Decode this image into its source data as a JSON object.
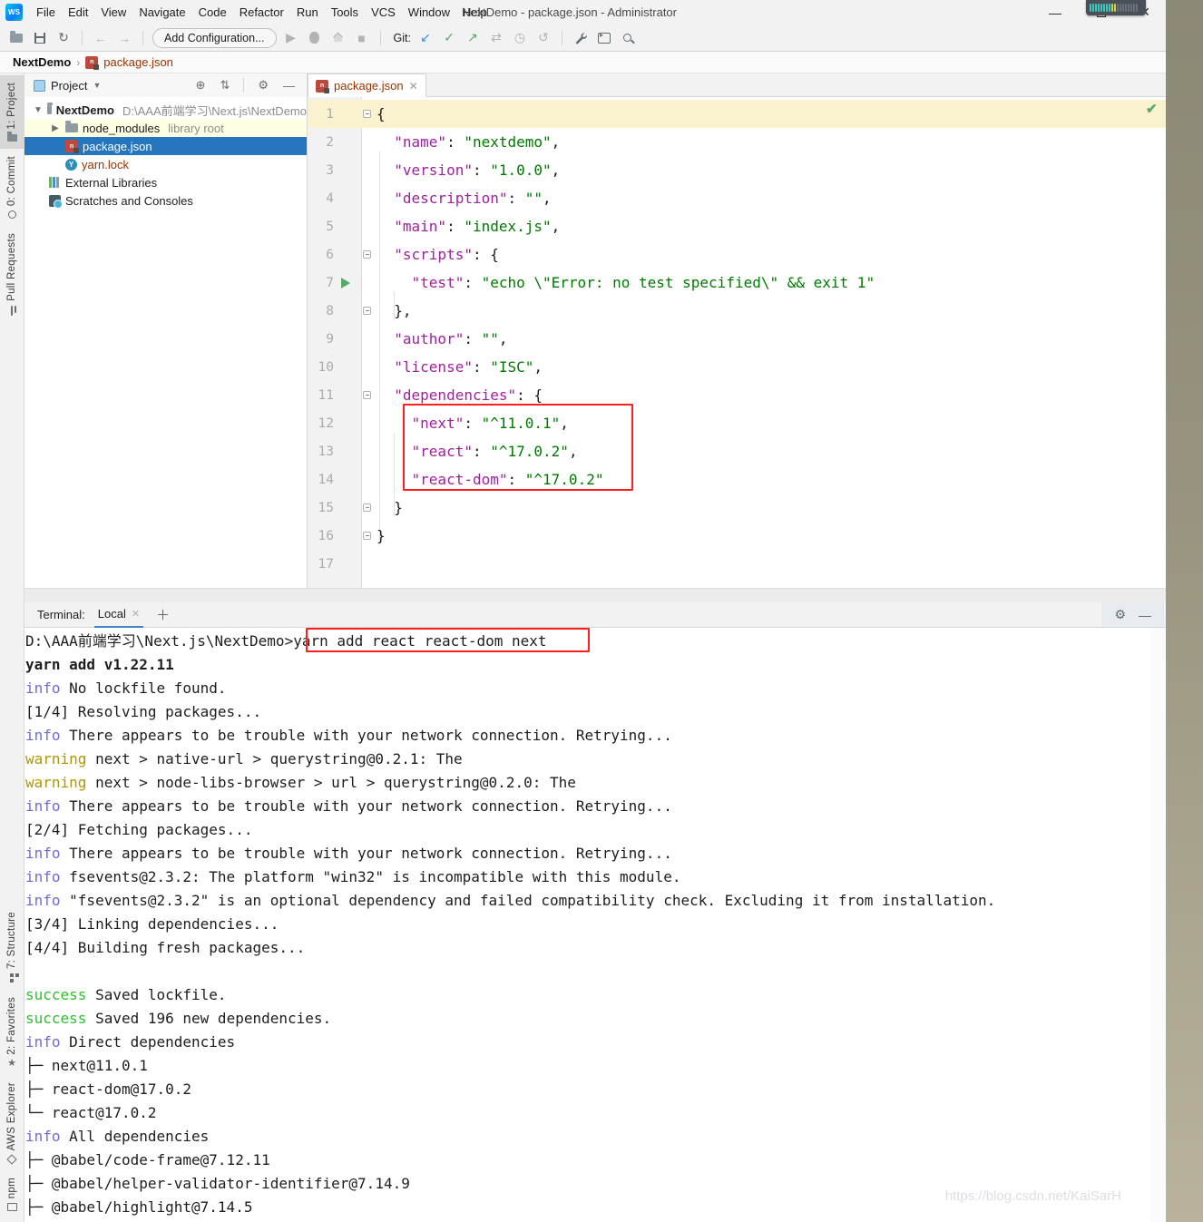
{
  "window": {
    "title": "NextDemo - package.json - Administrator"
  },
  "menu": {
    "items": [
      "File",
      "Edit",
      "View",
      "Navigate",
      "Code",
      "Refactor",
      "Run",
      "Tools",
      "VCS",
      "Window",
      "Help"
    ]
  },
  "toolbar": {
    "add_configuration_label": "Add Configuration...",
    "git_label": "Git:"
  },
  "breadcrumb": {
    "project": "NextDemo",
    "separator": "›",
    "file": "package.json"
  },
  "left_stripe": {
    "top": [
      {
        "label": "1: Project",
        "icon": "project-folder-icon",
        "active": true
      },
      {
        "label": "0: Commit",
        "icon": "commit-icon",
        "active": false
      },
      {
        "label": "Pull Requests",
        "icon": "pull-request-icon",
        "active": false
      }
    ],
    "bottom": [
      {
        "label": "7: Structure",
        "icon": "structure-icon",
        "active": false
      },
      {
        "label": "2: Favorites",
        "icon": "star-icon",
        "active": false
      },
      {
        "label": "AWS Explorer",
        "icon": "aws-cube-icon",
        "active": false
      },
      {
        "label": "npm",
        "icon": "npm-window-icon",
        "active": false
      }
    ]
  },
  "project_panel": {
    "header": {
      "title": "Project"
    },
    "tree": [
      {
        "label": "NextDemo",
        "suffix": "D:\\AAA前端学习\\Next.js\\NextDemo",
        "icon": "folder",
        "chevron": "expanded",
        "bold": true,
        "state": ""
      },
      {
        "label": "node_modules",
        "suffix": "library root",
        "icon": "folder",
        "chevron": "collapsed",
        "indent": 1,
        "state": "lib"
      },
      {
        "label": "package.json",
        "suffix": "",
        "icon": "npm",
        "chevron": "",
        "indent": 1,
        "state": "selected"
      },
      {
        "label": "yarn.lock",
        "suffix": "",
        "icon": "yarn",
        "chevron": "",
        "indent": 1,
        "state": "vcsred"
      },
      {
        "label": "External Libraries",
        "suffix": "",
        "icon": "libs",
        "chevron": "",
        "indent": 0,
        "state": ""
      },
      {
        "label": "Scratches and Consoles",
        "suffix": "",
        "icon": "scratch",
        "chevron": "",
        "indent": 0,
        "state": ""
      }
    ]
  },
  "editor": {
    "tab": {
      "label": "package.json"
    },
    "lines": [
      {
        "n": 1,
        "cur": true,
        "fold": "o",
        "tok": [
          [
            "p",
            "{"
          ]
        ]
      },
      {
        "n": 2,
        "tok": [
          [
            "p",
            "  "
          ],
          [
            "k",
            "\"name\""
          ],
          [
            "p",
            ": "
          ],
          [
            "s",
            "\"nextdemo\""
          ],
          [
            "p",
            ","
          ]
        ]
      },
      {
        "n": 3,
        "tok": [
          [
            "p",
            "  "
          ],
          [
            "k",
            "\"version\""
          ],
          [
            "p",
            ": "
          ],
          [
            "s",
            "\"1.0.0\""
          ],
          [
            "p",
            ","
          ]
        ]
      },
      {
        "n": 4,
        "tok": [
          [
            "p",
            "  "
          ],
          [
            "k",
            "\"description\""
          ],
          [
            "p",
            ": "
          ],
          [
            "s",
            "\"\""
          ],
          [
            "p",
            ","
          ]
        ]
      },
      {
        "n": 5,
        "tok": [
          [
            "p",
            "  "
          ],
          [
            "k",
            "\"main\""
          ],
          [
            "p",
            ": "
          ],
          [
            "s",
            "\"index.js\""
          ],
          [
            "p",
            ","
          ]
        ]
      },
      {
        "n": 6,
        "fold": "o",
        "tok": [
          [
            "p",
            "  "
          ],
          [
            "k",
            "\"scripts\""
          ],
          [
            "p",
            ": {"
          ]
        ]
      },
      {
        "n": 7,
        "run": true,
        "tok": [
          [
            "p",
            "    "
          ],
          [
            "k",
            "\"test\""
          ],
          [
            "p",
            ": "
          ],
          [
            "s",
            "\"echo \\\"Error: no test specified\\\" && exit 1\""
          ]
        ]
      },
      {
        "n": 8,
        "fold": "e",
        "tok": [
          [
            "p",
            "  },"
          ]
        ]
      },
      {
        "n": 9,
        "tok": [
          [
            "p",
            "  "
          ],
          [
            "k",
            "\"author\""
          ],
          [
            "p",
            ": "
          ],
          [
            "s",
            "\"\""
          ],
          [
            "p",
            ","
          ]
        ]
      },
      {
        "n": 10,
        "tok": [
          [
            "p",
            "  "
          ],
          [
            "k",
            "\"license\""
          ],
          [
            "p",
            ": "
          ],
          [
            "s",
            "\"ISC\""
          ],
          [
            "p",
            ","
          ]
        ]
      },
      {
        "n": 11,
        "fold": "o",
        "tok": [
          [
            "p",
            "  "
          ],
          [
            "k",
            "\"dependencies\""
          ],
          [
            "p",
            ": {"
          ]
        ]
      },
      {
        "n": 12,
        "tok": [
          [
            "p",
            "    "
          ],
          [
            "k",
            "\"next\""
          ],
          [
            "p",
            ": "
          ],
          [
            "s",
            "\"^11.0.1\""
          ],
          [
            "p",
            ","
          ]
        ]
      },
      {
        "n": 13,
        "tok": [
          [
            "p",
            "    "
          ],
          [
            "k",
            "\"react\""
          ],
          [
            "p",
            ": "
          ],
          [
            "s",
            "\"^17.0.2\""
          ],
          [
            "p",
            ","
          ]
        ]
      },
      {
        "n": 14,
        "tok": [
          [
            "p",
            "    "
          ],
          [
            "k",
            "\"react-dom\""
          ],
          [
            "p",
            ": "
          ],
          [
            "s",
            "\"^17.0.2\""
          ]
        ]
      },
      {
        "n": 15,
        "fold": "e",
        "tok": [
          [
            "p",
            "  }"
          ]
        ]
      },
      {
        "n": 16,
        "fold": "e",
        "tok": [
          [
            "p",
            "}"
          ]
        ]
      },
      {
        "n": 17,
        "tok": []
      }
    ]
  },
  "terminal": {
    "label": "Terminal:",
    "tab": "Local",
    "prompt": "D:\\AAA前端学习\\Next.js\\NextDemo",
    "command": ">yarn add react react-dom next",
    "lines": [
      {
        "k": "bold",
        "p": "",
        "t": "yarn add v1.22.11"
      },
      {
        "k": "info",
        "p": "info",
        "t": "No lockfile found."
      },
      {
        "k": "plain",
        "p": "",
        "t": "[1/4] Resolving packages..."
      },
      {
        "k": "info",
        "p": "info",
        "t": "There appears to be trouble with your network connection. Retrying..."
      },
      {
        "k": "warning",
        "p": "warning",
        "t": "next > native-url > querystring@0.2.1: The"
      },
      {
        "k": "warning",
        "p": "warning",
        "t": "next > node-libs-browser > url > querystring@0.2.0: The"
      },
      {
        "k": "info",
        "p": "info",
        "t": "There appears to be trouble with your network connection. Retrying..."
      },
      {
        "k": "plain",
        "p": "",
        "t": "[2/4] Fetching packages..."
      },
      {
        "k": "info",
        "p": "info",
        "t": "There appears to be trouble with your network connection. Retrying..."
      },
      {
        "k": "info",
        "p": "info",
        "t": "fsevents@2.3.2: The platform \"win32\" is incompatible with this module."
      },
      {
        "k": "info",
        "p": "info",
        "t": "\"fsevents@2.3.2\" is an optional dependency and failed compatibility check. Excluding it from installation."
      },
      {
        "k": "plain",
        "p": "",
        "t": "[3/4] Linking dependencies..."
      },
      {
        "k": "plain",
        "p": "",
        "t": "[4/4] Building fresh packages..."
      },
      {
        "k": "blank",
        "p": "",
        "t": ""
      },
      {
        "k": "success",
        "p": "success",
        "t": "Saved lockfile."
      },
      {
        "k": "success",
        "p": "success",
        "t": "Saved 196 new dependencies."
      },
      {
        "k": "info",
        "p": "info",
        "t": "Direct dependencies"
      },
      {
        "k": "plain",
        "p": "",
        "t": "├─ next@11.0.1"
      },
      {
        "k": "plain",
        "p": "",
        "t": "├─ react-dom@17.0.2"
      },
      {
        "k": "plain",
        "p": "",
        "t": "└─ react@17.0.2"
      },
      {
        "k": "info",
        "p": "info",
        "t": "All dependencies"
      },
      {
        "k": "plain",
        "p": "",
        "t": "├─ @babel/code-frame@7.12.11"
      },
      {
        "k": "plain",
        "p": "",
        "t": "├─ @babel/helper-validator-identifier@7.14.9"
      },
      {
        "k": "plain",
        "p": "",
        "t": "├─ @babel/highlight@7.14.5"
      }
    ]
  },
  "watermark": "https://blog.csdn.net/KaiSarH",
  "colors": {
    "key_purple": "#A021A0",
    "string_green": "#007A00",
    "info_blue": "#6E6BD8",
    "warning_gold": "#B39500",
    "success_green": "#2FBE2F",
    "selection_blue": "#2675BF",
    "vcs_unversioned_red": "#993300",
    "annotation_red": "#FF1F1F",
    "current_line_yellow": "#FAF1CE"
  }
}
